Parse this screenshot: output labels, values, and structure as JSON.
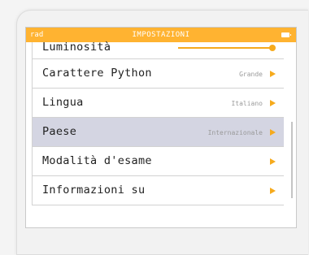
{
  "status_bar": {
    "mode": "rad",
    "title": "IMPOSTAZIONI",
    "battery_icon": "battery-full-icon"
  },
  "settings": {
    "items": [
      {
        "label": "Luminosità",
        "control": "slider",
        "level": 1.0
      },
      {
        "label": "Carattere Python",
        "value": "Grande"
      },
      {
        "label": "Lingua",
        "value": "Italiano"
      },
      {
        "label": "Paese",
        "value": "Internazionale",
        "selected": true
      },
      {
        "label": "Modalità d'esame",
        "value": ""
      },
      {
        "label": "Informazioni su",
        "value": ""
      }
    ]
  },
  "colors": {
    "accent": "#ffb331",
    "selection": "#d4d5e2"
  }
}
